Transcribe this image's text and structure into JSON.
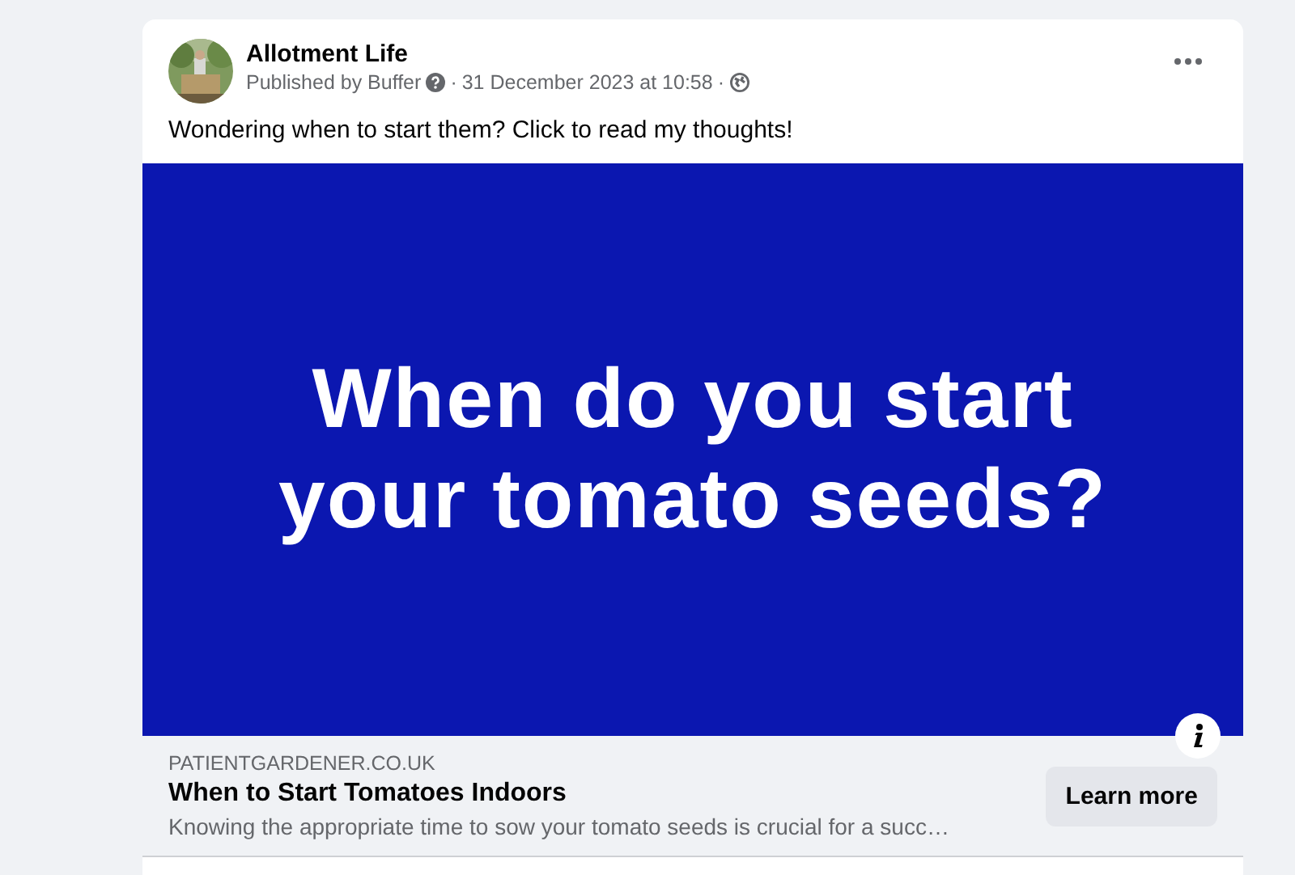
{
  "post": {
    "author": "Allotment Life",
    "published_by": "Published by Buffer",
    "date": "31 December 2023 at 10:58",
    "separator": "·",
    "text": "Wondering when to start them? Click to read my thoughts!"
  },
  "link_preview": {
    "image_text": "When do you start your tomato seeds?",
    "domain": "PATIENTGARDENER.CO.UK",
    "title": "When to Start Tomatoes Indoors",
    "description": "Knowing the appropriate time to sow your tomato seeds is crucial for a succ…",
    "button": "Learn more"
  }
}
